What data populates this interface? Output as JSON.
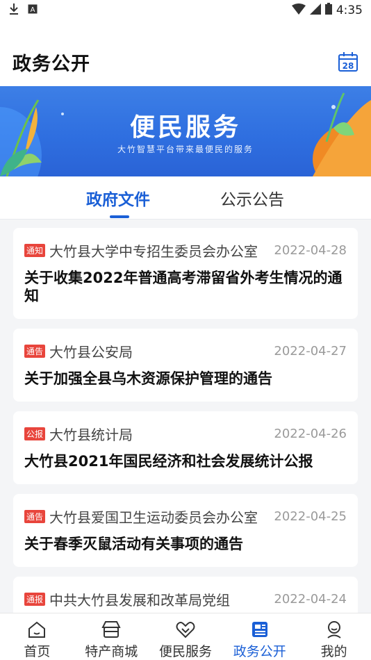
{
  "status": {
    "time": "4:35"
  },
  "header": {
    "title": "政务公开",
    "calendar_day": "28"
  },
  "banner": {
    "title": "便民服务",
    "subtitle": "大竹智慧平台带来最便民的服务"
  },
  "tabs": [
    {
      "label": "政府文件"
    },
    {
      "label": "公示公告"
    }
  ],
  "items": [
    {
      "tag": "通知",
      "dept": "大竹县大学中专招生委员会办公室",
      "date": "2022-04-28",
      "title": "关于收集2022年普通高考滞留省外考生情况的通知"
    },
    {
      "tag": "通告",
      "dept": "大竹县公安局",
      "date": "2022-04-27",
      "title": "关于加强全县乌木资源保护管理的通告"
    },
    {
      "tag": "公报",
      "dept": "大竹县统计局",
      "date": "2022-04-26",
      "title": "大竹县2021年国民经济和社会发展统计公报"
    },
    {
      "tag": "通告",
      "dept": "大竹县爱国卫生运动委员会办公室",
      "date": "2022-04-25",
      "title": "关于春季灭鼠活动有关事项的通告"
    },
    {
      "tag": "通报",
      "dept": "中共大竹县发展和改革局党组",
      "date": "2022-04-24",
      "title": ""
    }
  ],
  "nav": [
    {
      "label": "首页"
    },
    {
      "label": "特产商城"
    },
    {
      "label": "便民服务"
    },
    {
      "label": "政务公开"
    },
    {
      "label": "我的"
    }
  ],
  "colors": {
    "accent": "#1a5fd6",
    "tag_red": "#e8453c"
  }
}
